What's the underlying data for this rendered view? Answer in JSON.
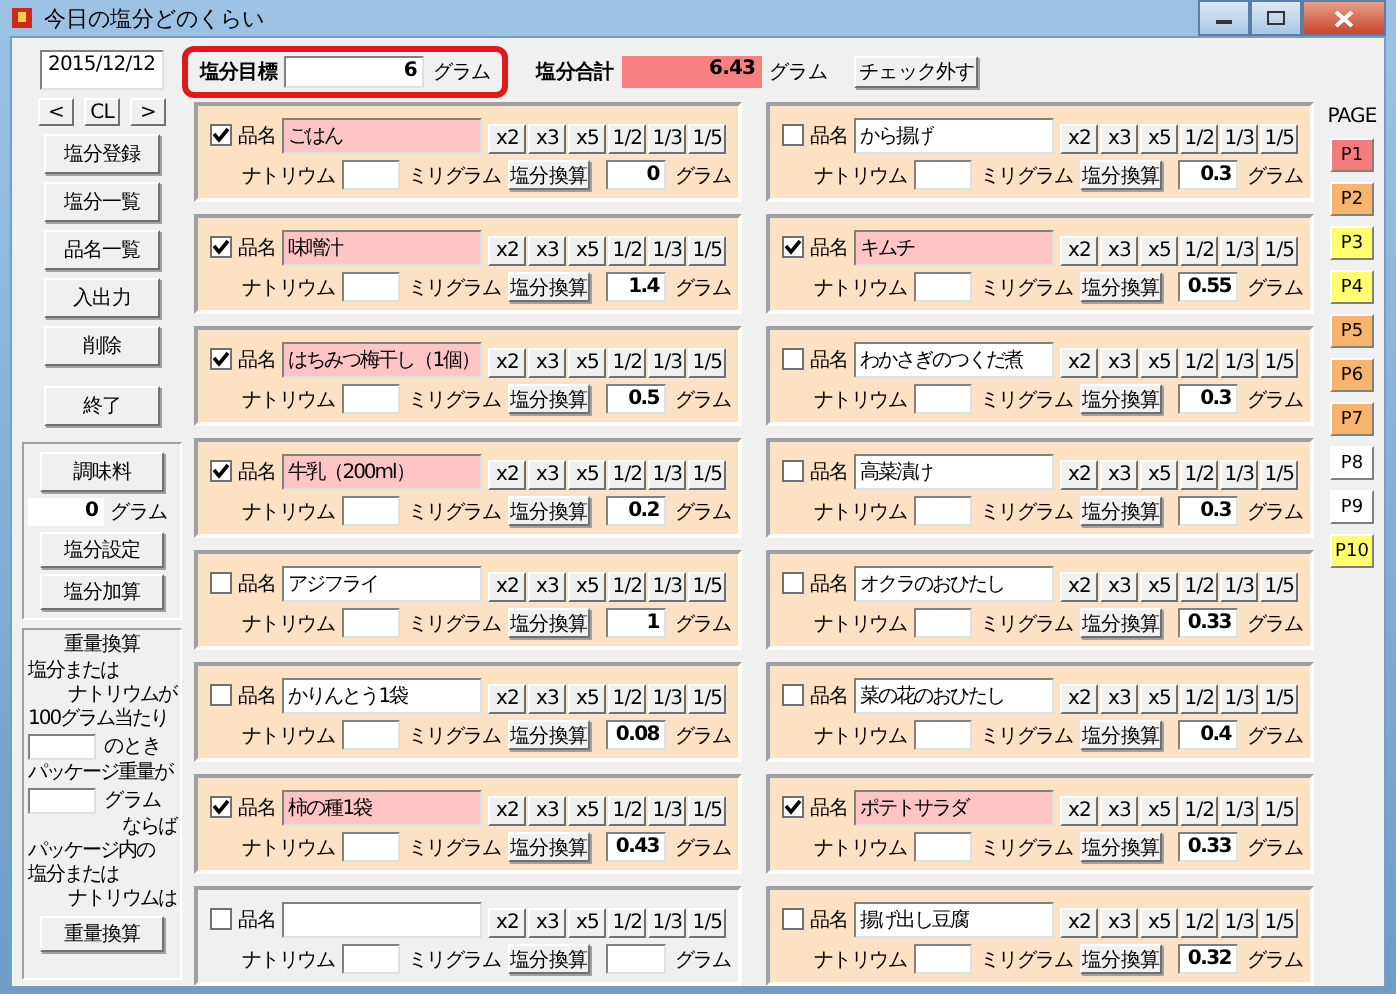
{
  "window": {
    "title": "今日の塩分どのくらい"
  },
  "sidebar": {
    "date": "2015/12/12",
    "nav_buttons": [
      "<",
      "CL",
      ">"
    ],
    "buttons": [
      "塩分登録",
      "塩分一覧",
      "品名一覧",
      "入出力",
      "削除",
      "終了"
    ],
    "seasoning": {
      "button": "調味料",
      "value": "0",
      "unit": "グラム",
      "buttons": [
        "塩分設定",
        "塩分加算"
      ]
    },
    "weight_conversion": {
      "title": "重量換算",
      "rows": [
        {
          "kind": "text",
          "text": "塩分または"
        },
        {
          "kind": "text_right",
          "text": "ナトリウムが"
        },
        {
          "kind": "text",
          "text": "100グラム当たり"
        },
        {
          "kind": "input",
          "text": "のとき"
        },
        {
          "kind": "text",
          "text": "パッケージ重量が"
        },
        {
          "kind": "input",
          "text": "グラム"
        },
        {
          "kind": "text_right",
          "text": "ならば"
        },
        {
          "kind": "text",
          "text": "パッケージ内の"
        },
        {
          "kind": "text",
          "text": "塩分または"
        },
        {
          "kind": "text_right",
          "text": "ナトリウムは"
        }
      ],
      "button": "重量換算"
    }
  },
  "header": {
    "target": {
      "label": "塩分目標",
      "value": "6",
      "unit": "グラム"
    },
    "total": {
      "label": "塩分合計",
      "value": "6.43",
      "unit": "グラム"
    },
    "uncheck_button": "チェック外す"
  },
  "left_column": [
    {
      "checked": true,
      "name_label": "品名",
      "name": "ごはん",
      "factors": [
        "x2",
        "x3",
        "x5",
        "1/2",
        "1/3",
        "1/5"
      ],
      "sodium_label": "ナトリウム",
      "mg_label": "ミリグラム",
      "convert_button": "塩分換算",
      "salt": "0",
      "unit": "グラム"
    },
    {
      "checked": true,
      "name_label": "品名",
      "name": "味噌汁",
      "factors": [
        "x2",
        "x3",
        "x5",
        "1/2",
        "1/3",
        "1/5"
      ],
      "sodium_label": "ナトリウム",
      "mg_label": "ミリグラム",
      "convert_button": "塩分換算",
      "salt": "1.4",
      "unit": "グラム"
    },
    {
      "checked": true,
      "name_label": "品名",
      "name": "はちみつ梅干し（1個）",
      "factors": [
        "x2",
        "x3",
        "x5",
        "1/2",
        "1/3",
        "1/5"
      ],
      "sodium_label": "ナトリウム",
      "mg_label": "ミリグラム",
      "convert_button": "塩分換算",
      "salt": "0.5",
      "unit": "グラム"
    },
    {
      "checked": true,
      "name_label": "品名",
      "name": "牛乳（200ml）",
      "factors": [
        "x2",
        "x3",
        "x5",
        "1/2",
        "1/3",
        "1/5"
      ],
      "sodium_label": "ナトリウム",
      "mg_label": "ミリグラム",
      "convert_button": "塩分換算",
      "salt": "0.2",
      "unit": "グラム"
    },
    {
      "checked": false,
      "name_label": "品名",
      "name": "アジフライ",
      "factors": [
        "x2",
        "x3",
        "x5",
        "1/2",
        "1/3",
        "1/5"
      ],
      "sodium_label": "ナトリウム",
      "mg_label": "ミリグラム",
      "convert_button": "塩分換算",
      "salt": "1",
      "unit": "グラム"
    },
    {
      "checked": false,
      "name_label": "品名",
      "name": "かりんとう1袋",
      "factors": [
        "x2",
        "x3",
        "x5",
        "1/2",
        "1/3",
        "1/5"
      ],
      "sodium_label": "ナトリウム",
      "mg_label": "ミリグラム",
      "convert_button": "塩分換算",
      "salt": "0.08",
      "unit": "グラム"
    },
    {
      "checked": true,
      "name_label": "品名",
      "name": "柿の種1袋",
      "factors": [
        "x2",
        "x3",
        "x5",
        "1/2",
        "1/3",
        "1/5"
      ],
      "sodium_label": "ナトリウム",
      "mg_label": "ミリグラム",
      "convert_button": "塩分換算",
      "salt": "0.43",
      "unit": "グラム"
    },
    {
      "checked": false,
      "name_label": "品名",
      "factors": [
        "x2",
        "x3",
        "x5",
        "1/2",
        "1/3",
        "1/5"
      ],
      "sodium_label": "ナトリウム",
      "mg_label": "ミリグラム",
      "convert_button": "塩分換算",
      "unit": "グラム"
    }
  ],
  "right_column": [
    {
      "checked": false,
      "name_label": "品名",
      "name": "から揚げ",
      "factors": [
        "x2",
        "x3",
        "x5",
        "1/2",
        "1/3",
        "1/5"
      ],
      "sodium_label": "ナトリウム",
      "mg_label": "ミリグラム",
      "convert_button": "塩分換算",
      "salt": "0.3",
      "unit": "グラム"
    },
    {
      "checked": true,
      "name_label": "品名",
      "name": "キムチ",
      "factors": [
        "x2",
        "x3",
        "x5",
        "1/2",
        "1/3",
        "1/5"
      ],
      "sodium_label": "ナトリウム",
      "mg_label": "ミリグラム",
      "convert_button": "塩分換算",
      "salt": "0.55",
      "unit": "グラム"
    },
    {
      "checked": false,
      "name_label": "品名",
      "name": "わかさぎのつくだ煮",
      "factors": [
        "x2",
        "x3",
        "x5",
        "1/2",
        "1/3",
        "1/5"
      ],
      "sodium_label": "ナトリウム",
      "mg_label": "ミリグラム",
      "convert_button": "塩分換算",
      "salt": "0.3",
      "unit": "グラム"
    },
    {
      "checked": false,
      "name_label": "品名",
      "name": "高菜漬け",
      "factors": [
        "x2",
        "x3",
        "x5",
        "1/2",
        "1/3",
        "1/5"
      ],
      "sodium_label": "ナトリウム",
      "mg_label": "ミリグラム",
      "convert_button": "塩分換算",
      "salt": "0.3",
      "unit": "グラム"
    },
    {
      "checked": false,
      "name_label": "品名",
      "name": "オクラのおひたし",
      "factors": [
        "x2",
        "x3",
        "x5",
        "1/2",
        "1/3",
        "1/5"
      ],
      "sodium_label": "ナトリウム",
      "mg_label": "ミリグラム",
      "convert_button": "塩分換算",
      "salt": "0.33",
      "unit": "グラム"
    },
    {
      "checked": false,
      "name_label": "品名",
      "name": "菜の花のおひたし",
      "factors": [
        "x2",
        "x3",
        "x5",
        "1/2",
        "1/3",
        "1/5"
      ],
      "sodium_label": "ナトリウム",
      "mg_label": "ミリグラム",
      "convert_button": "塩分換算",
      "salt": "0.4",
      "unit": "グラム"
    },
    {
      "checked": true,
      "name_label": "品名",
      "name": "ポテトサラダ",
      "factors": [
        "x2",
        "x3",
        "x5",
        "1/2",
        "1/3",
        "1/5"
      ],
      "sodium_label": "ナトリウム",
      "mg_label": "ミリグラム",
      "convert_button": "塩分換算",
      "salt": "0.33",
      "unit": "グラム"
    },
    {
      "checked": false,
      "name_label": "品名",
      "name": "揚げ出し豆腐",
      "factors": [
        "x2",
        "x3",
        "x5",
        "1/2",
        "1/3",
        "1/5"
      ],
      "sodium_label": "ナトリウム",
      "mg_label": "ミリグラム",
      "convert_button": "塩分換算",
      "salt": "0.32",
      "unit": "グラム"
    }
  ],
  "pages": {
    "label": "PAGE",
    "buttons": [
      {
        "label": "P1",
        "color": "#f47c7c"
      },
      {
        "label": "P2",
        "color": "#f8b46c"
      },
      {
        "label": "P3",
        "color": "#ffff70"
      },
      {
        "label": "P4",
        "color": "#ffff70"
      },
      {
        "label": "P5",
        "color": "#f8b46c"
      },
      {
        "label": "P6",
        "color": "#f8b46c"
      },
      {
        "label": "P7",
        "color": "#f8b46c"
      },
      {
        "label": "P8",
        "color": "#ffffff"
      },
      {
        "label": "P9",
        "color": "#ffffff"
      },
      {
        "label": "P10",
        "color": "#ffff70"
      }
    ]
  }
}
